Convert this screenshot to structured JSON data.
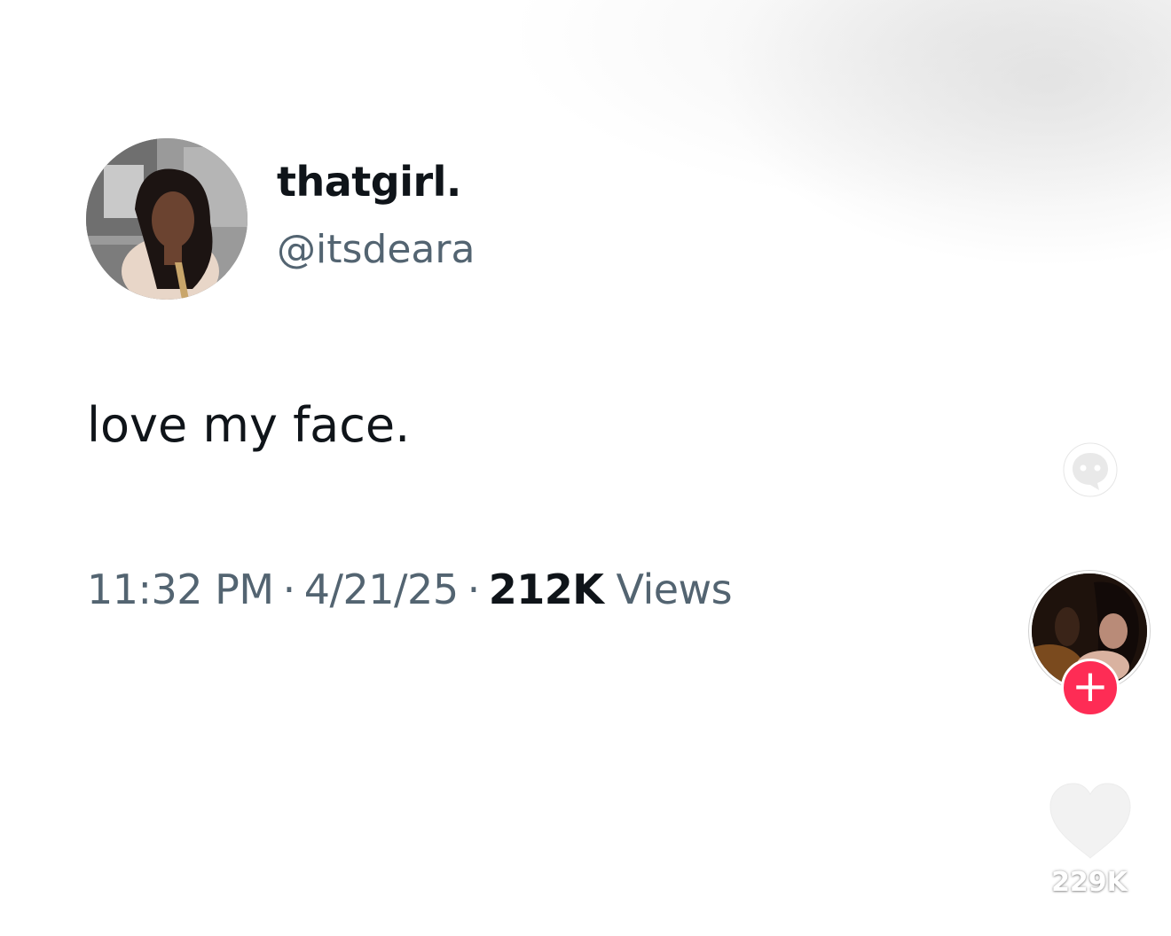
{
  "tweet": {
    "display_name": "thatgirl.",
    "handle": "@itsdeara",
    "text": "love my face.",
    "time": "11:32 PM",
    "date": "4/21/25",
    "separator": "·",
    "views_count": "212K",
    "views_label": "Views"
  },
  "rail": {
    "chat_icon": "chat-bubble-icon",
    "follow_icon": "plus-icon",
    "follow_label": "+",
    "like_icon": "heart-icon",
    "like_count": "229K"
  },
  "colors": {
    "follow_accent": "#fe2c55",
    "primary_text": "#0f1419",
    "secondary_text": "#536471"
  }
}
